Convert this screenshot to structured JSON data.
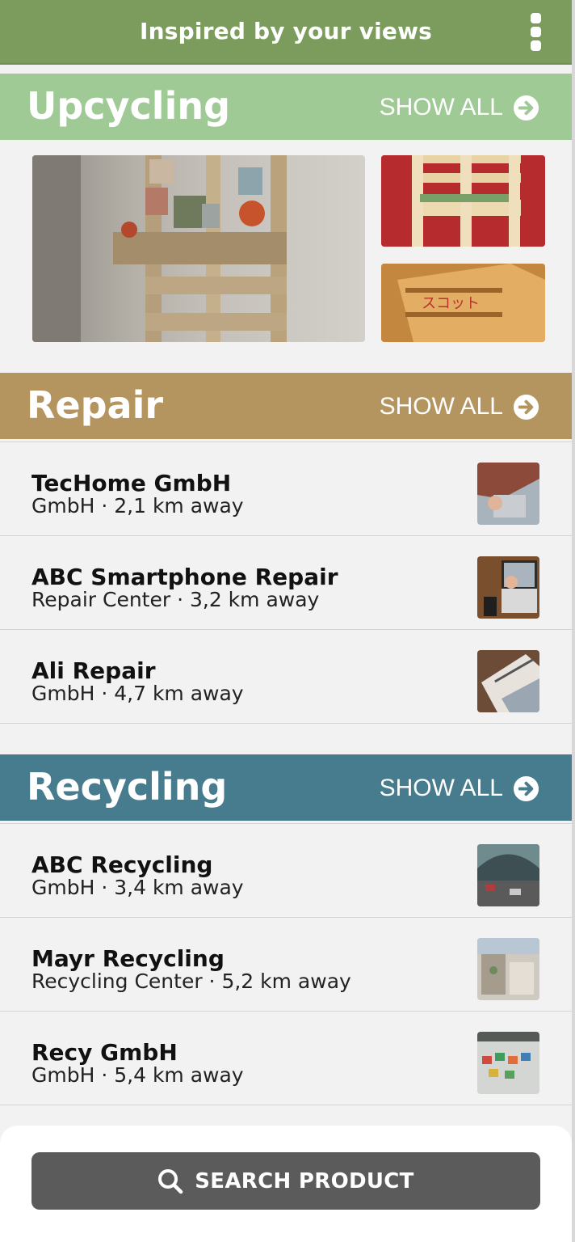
{
  "header": {
    "title": "Inspired by your views",
    "menu_icon": "more-vertical-icon"
  },
  "sections": {
    "upcycling": {
      "title": "Upcycling",
      "show_all": "SHOW ALL",
      "color": "#9fc995"
    },
    "repair": {
      "title": "Repair",
      "show_all": "SHOW ALL",
      "color": "#b4955f",
      "items": [
        {
          "name": "TecHome GmbH",
          "sub": "GmbH · 2,1 km away"
        },
        {
          "name": "ABC Smartphone Repair",
          "sub": "Repair Center · 3,2 km away"
        },
        {
          "name": "Ali Repair",
          "sub": "GmbH · 4,7 km away"
        }
      ]
    },
    "recycling": {
      "title": "Recycling",
      "show_all": "SHOW ALL",
      "color": "#477c8f",
      "items": [
        {
          "name": "ABC Recycling",
          "sub": "GmbH · 3,4 km away"
        },
        {
          "name": "Mayr Recycling",
          "sub": "Recycling Center · 5,2 km away"
        },
        {
          "name": "Recy GmbH",
          "sub": "GmbH · 5,4 km away"
        }
      ]
    }
  },
  "search": {
    "label": "SEARCH PRODUCT",
    "color": "#5b5b5b"
  },
  "topbar_color": "#7c9c5e"
}
